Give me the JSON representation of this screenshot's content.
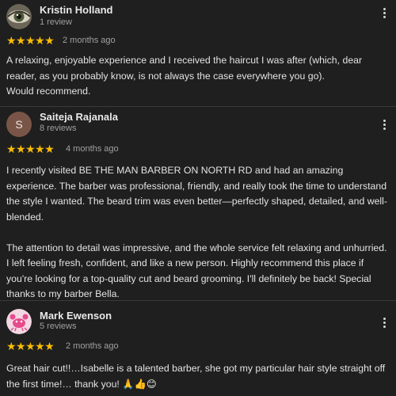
{
  "reviews": [
    {
      "name": "Kristin Holland",
      "meta": "1 review",
      "rating_icons": "★★★★★",
      "rating": 5,
      "date": "2 months ago",
      "text": "A relaxing, enjoyable experience and I received the haircut I was after (which, dear reader, as you probably know, is not always the case everywhere you go).\nWould recommend.",
      "avatar_icon": "eye-photo-avatar"
    },
    {
      "name": "Saiteja Rajanala",
      "meta": "8 reviews",
      "avatar_letter": "S",
      "rating_icons": "★★★★★",
      "rating": 5,
      "date": "4 months ago",
      "text": "I recently visited BE THE MAN BARBER ON NORTH RD and had an amazing experience. The barber was professional, friendly, and really took the time to understand the style I wanted. The beard trim was even better—perfectly shaped, detailed, and well-blended.\n\nThe attention to detail was impressive, and the whole service felt relaxing and unhurried. I left feeling fresh, confident, and like a new person. Highly recommend this place if you're looking for a top-quality cut and beard grooming. I'll definitely be back! Special thanks to my barber Bella.",
      "avatar_color": "#795548"
    },
    {
      "name": "Mark Ewenson",
      "meta": "5 reviews",
      "rating_icons": "★★★★★",
      "rating": 5,
      "date": "2 months ago",
      "text": "Great hair cut!!…Isabelle is a talented barber, she got my particular hair style straight off the first time!… thank you! 🙏👍😊",
      "avatar_icon": "pink-crab-avatar"
    }
  ],
  "colors": {
    "background": "#1f1f1f",
    "star": "#fbbc04",
    "divider": "#3a3a3a"
  }
}
